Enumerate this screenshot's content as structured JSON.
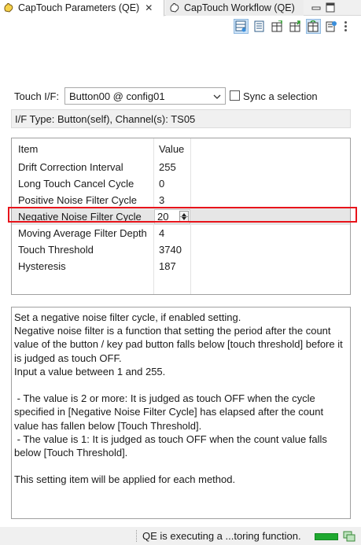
{
  "tabs": [
    {
      "label": "CapTouch Parameters (QE)",
      "active": true
    },
    {
      "label": "CapTouch Workflow (QE)",
      "active": false
    }
  ],
  "toolbar": {
    "icons": [
      "view-table-icon",
      "view-list-icon",
      "import-icon",
      "export-icon",
      "apply-icon",
      "settings-icon",
      "more-icon"
    ]
  },
  "touch_if": {
    "label": "Touch I/F:",
    "selected": "Button00 @ config01",
    "sync_label": "Sync a selection",
    "sync_checked": false
  },
  "if_type": "I/F Type: Button(self), Channel(s): TS05",
  "table": {
    "headers": [
      "Item",
      "Value"
    ],
    "rows": [
      {
        "item": "Drift Correction Interval",
        "value": "255"
      },
      {
        "item": "Long Touch Cancel Cycle",
        "value": "0"
      },
      {
        "item": "Positive Noise Filter Cycle",
        "value": "3"
      },
      {
        "item": "Negative Noise Filter Cycle",
        "value": "20"
      },
      {
        "item": "Moving Average Filter Depth",
        "value": "4"
      },
      {
        "item": "Touch Threshold",
        "value": "3740"
      },
      {
        "item": "Hysteresis",
        "value": "187"
      }
    ]
  },
  "description": "Set a negative noise filter cycle, if enabled setting.\nNegative noise filter is a function that setting the period after the count value of the button / key pad button falls below [touch threshold] before it is judged as touch OFF.\nInput a value between 1 and 255.\n\n - The value is 2 or more: It is judged as touch OFF when the cycle specified in [Negative Noise Filter Cycle] has elapsed after the count value has fallen below [Touch Threshold].\n - The value is 1: It is judged as touch OFF when the count value falls below [Touch Threshold].\n\nThis setting item will be applied for each method.",
  "status": {
    "text": "QE is executing a ...toring function.",
    "progress_color": "#1fa830"
  },
  "colors": {
    "highlight": "#e8141b",
    "toolbar_pressed": "#cde3f7"
  }
}
